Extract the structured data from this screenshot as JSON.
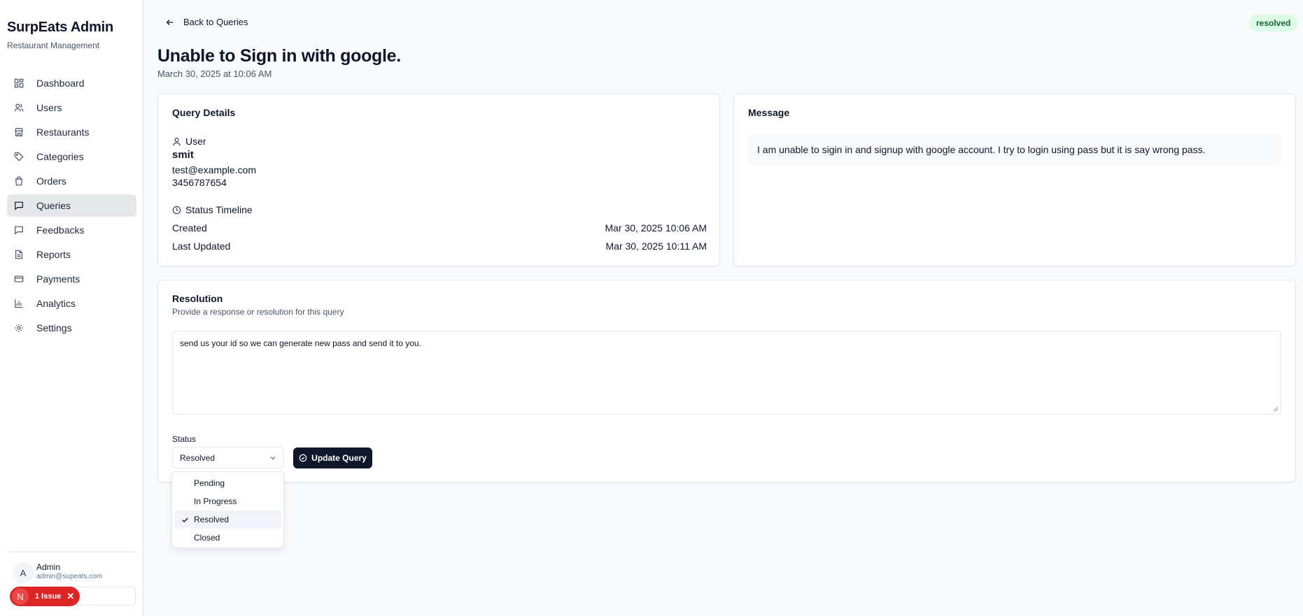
{
  "sidebar": {
    "brand": "SurpEats Admin",
    "subtitle": "Restaurant Management",
    "items": [
      {
        "label": "Dashboard",
        "icon": "dashboard-icon"
      },
      {
        "label": "Users",
        "icon": "users-icon"
      },
      {
        "label": "Restaurants",
        "icon": "store-icon"
      },
      {
        "label": "Categories",
        "icon": "tag-icon"
      },
      {
        "label": "Orders",
        "icon": "shopping-bag-icon"
      },
      {
        "label": "Queries",
        "icon": "message-icon",
        "active": true
      },
      {
        "label": "Feedbacks",
        "icon": "message-icon"
      },
      {
        "label": "Reports",
        "icon": "file-icon"
      },
      {
        "label": "Payments",
        "icon": "credit-card-icon"
      },
      {
        "label": "Analytics",
        "icon": "bar-chart-icon"
      },
      {
        "label": "Settings",
        "icon": "gear-icon"
      }
    ],
    "user": {
      "initial": "A",
      "name": "Admin",
      "email": "admin@supeats.com"
    },
    "issue_badge": {
      "initial": "N",
      "label": "1 Issue",
      "close": "✕"
    }
  },
  "header": {
    "back_label": "Back to Queries",
    "status_badge": "resolved",
    "title": "Unable to Sign in with google.",
    "date": "March 30, 2025 at 10:06 AM"
  },
  "details": {
    "title": "Query Details",
    "user_heading": "User",
    "user_name": "smit",
    "user_email": "test@example.com",
    "user_phone": "3456787654",
    "timeline_heading": "Status Timeline",
    "created_label": "Created",
    "created_value": "Mar 30, 2025 10:06 AM",
    "updated_label": "Last Updated",
    "updated_value": "Mar 30, 2025 10:11 AM"
  },
  "message": {
    "title": "Message",
    "text": "I am unable to sigin in and signup with google account. I try to login using pass but it is say wrong pass."
  },
  "resolution": {
    "title": "Resolution",
    "subtitle": "Provide a response or resolution for this query",
    "text": "send us your id so we can generate new pass and send it to you.",
    "status_label": "Status",
    "status_value": "Resolved",
    "update_label": "Update Query",
    "options": [
      "Pending",
      "In Progress",
      "Resolved",
      "Closed"
    ],
    "selected_option": "Resolved"
  },
  "colors": {
    "primary": "#0f172a",
    "badge_bg": "#dcfce7",
    "badge_text": "#166534",
    "issue": "#dc2626"
  }
}
